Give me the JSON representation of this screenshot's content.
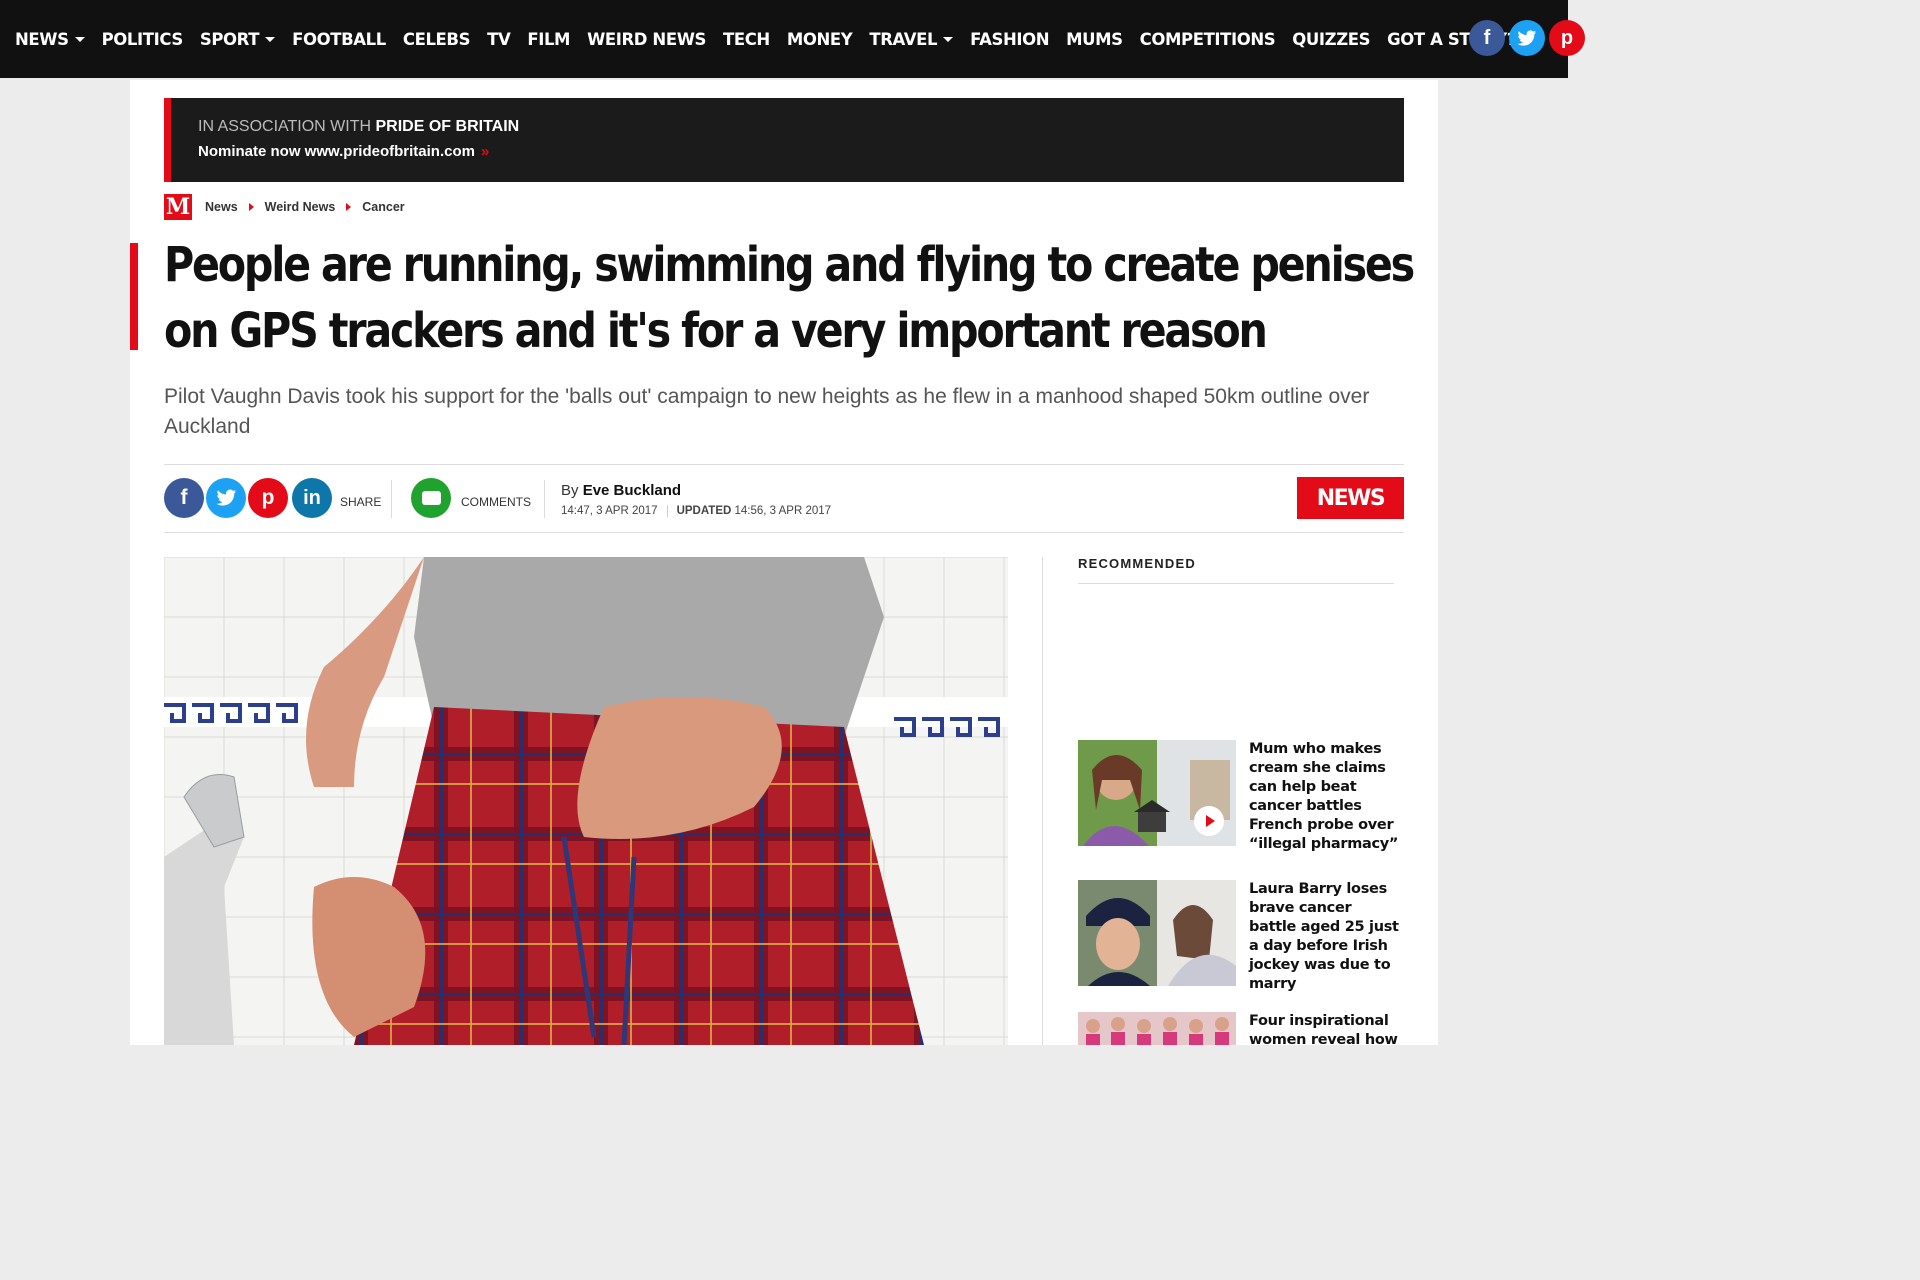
{
  "nav": {
    "items": [
      {
        "label": "NEWS",
        "dropdown": true
      },
      {
        "label": "POLITICS",
        "dropdown": false
      },
      {
        "label": "SPORT",
        "dropdown": true
      },
      {
        "label": "FOOTBALL",
        "dropdown": false
      },
      {
        "label": "CELEBS",
        "dropdown": false
      },
      {
        "label": "TV",
        "dropdown": false
      },
      {
        "label": "FILM",
        "dropdown": false
      },
      {
        "label": "WEIRD NEWS",
        "dropdown": false
      },
      {
        "label": "TECH",
        "dropdown": false
      },
      {
        "label": "MONEY",
        "dropdown": false
      },
      {
        "label": "TRAVEL",
        "dropdown": true
      },
      {
        "label": "FASHION",
        "dropdown": false
      },
      {
        "label": "MUMS",
        "dropdown": false
      },
      {
        "label": "COMPETITIONS",
        "dropdown": false
      },
      {
        "label": "QUIZZES",
        "dropdown": false
      },
      {
        "label": "GOT A STORY?",
        "dropdown": false
      }
    ],
    "social": [
      {
        "name": "facebook-icon",
        "glyph": "f",
        "color": "#3b5998"
      },
      {
        "name": "twitter-icon",
        "glyph": "t",
        "color": "#1da1f2"
      },
      {
        "name": "pinterest-icon",
        "glyph": "p",
        "color": "#e30b17"
      }
    ]
  },
  "association": {
    "prefix": "IN ASSOCIATION WITH",
    "brand": "PRIDE OF BRITAIN",
    "nominate": "Nominate now www.prideofbritain.com",
    "arrow": "»"
  },
  "breadcrumb": {
    "logo": "M",
    "items": [
      "News",
      "Weird News",
      "Cancer"
    ]
  },
  "article": {
    "headline": "People are running, swimming and flying to create penises on GPS trackers and it's for a very important reason",
    "standfirst": "Pilot Vaughn Davis took his support for the 'balls out' campaign to new heights as he flew in a manhood shaped 50km outline over Auckland",
    "share_label": "SHARE",
    "comments_label": "COMMENTS",
    "by": "By",
    "author": "Eve Buckland",
    "published": "14:47, 3 APR 2017",
    "updated_label": "UPDATED",
    "updated": "14:56, 3 APR 2017",
    "category_badge": "NEWS"
  },
  "share_buttons": [
    {
      "name": "facebook-share-icon",
      "glyph": "f",
      "color": "#3b5998"
    },
    {
      "name": "twitter-share-icon",
      "glyph": "t",
      "color": "#1da1f2"
    },
    {
      "name": "pinterest-share-icon",
      "glyph": "p",
      "color": "#e30b17"
    },
    {
      "name": "linkedin-share-icon",
      "glyph": "in",
      "color": "#0e76a8"
    }
  ],
  "recommended": {
    "title": "RECOMMENDED",
    "items": [
      {
        "headline": "Mum who makes cream she claims can help beat cancer battles French probe over “illegal pharmacy”",
        "has_video": true
      },
      {
        "headline": "Laura Barry loses brave cancer battle aged 25 just a day before Irish jockey was due to marry",
        "has_video": false
      },
      {
        "headline": "Four inspirational women reveal how",
        "has_video": false
      }
    ]
  },
  "colors": {
    "brand_red": "#e30b17",
    "nav_bg": "#111111",
    "comments_green": "#1fa22e"
  }
}
